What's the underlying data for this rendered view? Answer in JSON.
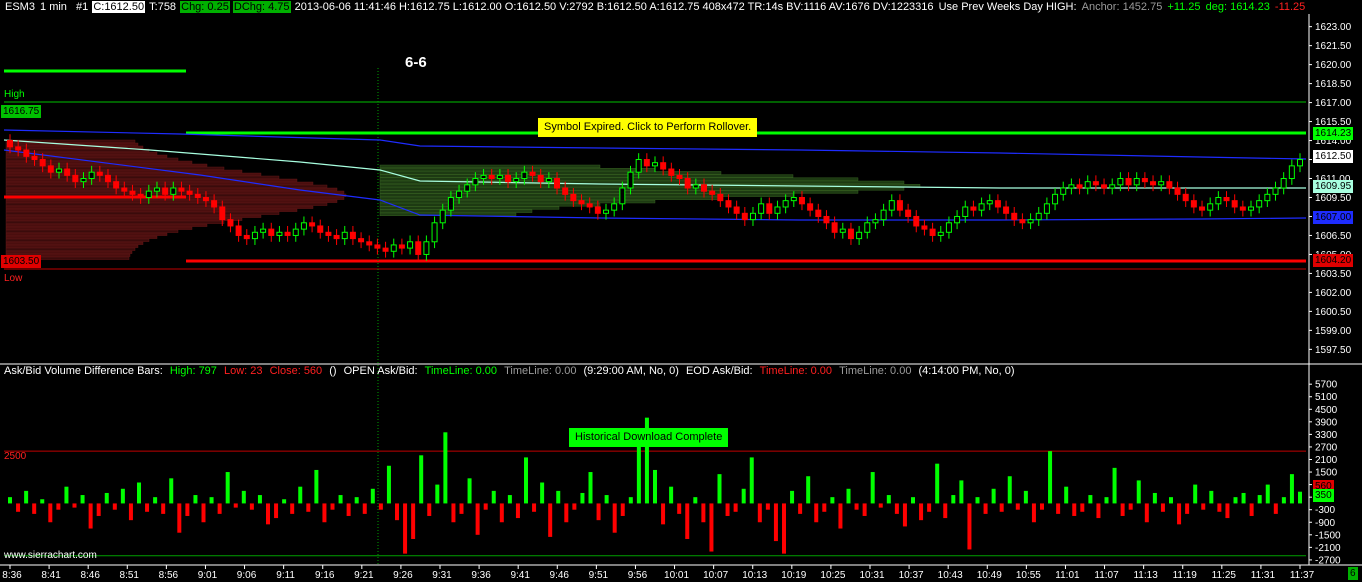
{
  "header": {
    "symbol": "ESM3",
    "interval": "1 min",
    "chart_no": "#1",
    "close_box": "C:1612.50",
    "ticks": "T:758",
    "chg": "Chg: 0.25",
    "dchg": "DChg: 4.75",
    "info": "2013-06-06 11:41:46 H:1612.75 L:1612.00 O:1612.50 V:2792 B:1612.50 A:1612.75 408x472 TR:14s BV:1116 AV:1676 DV:1223316",
    "prev_weeks": "Use Prev Weeks Day HIGH:",
    "anchor": "Anchor: 1452.75",
    "plus": "+11.25",
    "deg": "deg: 1614.23",
    "minus": "-11.25"
  },
  "chart_title": "6-6",
  "notices": {
    "rollover": "Symbol Expired. Click to Perform Rollover.",
    "download": "Historical Download Complete"
  },
  "markers": {
    "high_label": "High",
    "high_value": "1616.75",
    "low_value": "1603.50",
    "low_label": "Low",
    "line_1614": "1614.23",
    "last_price": "1612.50",
    "vwap": "1609.95",
    "blue_lower": "1607.00",
    "line_1604": "1604.20",
    "sub_2500": "2500",
    "sub_cur": "560",
    "sub_cur2": "350"
  },
  "subgraph": {
    "name": "Ask/Bid Volume Difference Bars:",
    "high": "High: 797",
    "low": "Low: 23",
    "close": "Close: 560",
    "paren": "()",
    "open_name": "OPEN Ask/Bid:",
    "open_tl": "TimeLine: 0.00",
    "open_tl2": "TimeLine: 0.00",
    "open_info": "(9:29:00 AM, No, 0)",
    "eod_name": "EOD Ask/Bid:",
    "eod_tl": "TimeLine: 0.00",
    "eod_tl2": "TimeLine: 0.00",
    "eod_info": "(4:14:00 PM, No, 0)"
  },
  "watermark": "www.sierrachart.com",
  "corner_tag": "6",
  "colors": {
    "up": "#00ff00",
    "down": "#ff0000",
    "bg": "#000000",
    "blue": "#1e2cff",
    "cyan": "#a8ffe0"
  },
  "chart_data": [
    {
      "type": "candlestick",
      "title": "6-6",
      "price_axis": [
        "1623.00",
        "1621.50",
        "1620.00",
        "1618.50",
        "1617.00",
        "1615.50",
        "1614.00",
        "1612.50",
        "1611.00",
        "1609.50",
        "1608.00",
        "1606.50",
        "1605.00",
        "1603.50",
        "1602.00",
        "1600.50",
        "1599.00",
        "1597.50"
      ],
      "ylim": [
        1596.5,
        1624.0
      ],
      "x_ticks": [
        "8:36",
        "8:41",
        "8:46",
        "8:51",
        "8:56",
        "9:01",
        "9:06",
        "9:11",
        "9:16",
        "9:21",
        "9:26",
        "9:31",
        "9:36",
        "9:41",
        "9:46",
        "9:51",
        "9:56",
        "10:01",
        "10:07",
        "10:13",
        "10:19",
        "10:25",
        "10:31",
        "10:37",
        "10:43",
        "10:49",
        "10:55",
        "11:01",
        "11:07",
        "11:13",
        "11:19",
        "11:25",
        "11:31",
        "11:37"
      ],
      "closes": [
        1613.5,
        1613.25,
        1612.75,
        1612.5,
        1612.0,
        1611.5,
        1611.75,
        1611.25,
        1610.75,
        1611.0,
        1611.5,
        1611.25,
        1610.75,
        1610.25,
        1610.0,
        1609.75,
        1609.5,
        1610.0,
        1610.25,
        1609.75,
        1610.25,
        1610.0,
        1609.75,
        1609.5,
        1609.25,
        1608.75,
        1607.75,
        1607.25,
        1606.5,
        1606.25,
        1606.75,
        1607.0,
        1606.5,
        1606.75,
        1606.5,
        1607.0,
        1607.5,
        1607.25,
        1606.75,
        1606.5,
        1606.25,
        1606.75,
        1606.25,
        1606.0,
        1605.75,
        1605.5,
        1605.25,
        1605.75,
        1605.5,
        1606.0,
        1605.0,
        1606.0,
        1607.5,
        1608.5,
        1609.5,
        1610.0,
        1610.5,
        1611.0,
        1611.25,
        1611.0,
        1611.25,
        1610.75,
        1611.0,
        1611.5,
        1611.25,
        1610.75,
        1611.0,
        1610.25,
        1609.75,
        1609.25,
        1609.0,
        1608.75,
        1608.25,
        1608.5,
        1609.0,
        1610.25,
        1611.5,
        1612.5,
        1612.0,
        1612.25,
        1611.75,
        1611.25,
        1611.0,
        1610.25,
        1610.5,
        1610.0,
        1609.75,
        1609.25,
        1608.75,
        1608.25,
        1607.75,
        1608.25,
        1609.0,
        1608.25,
        1608.75,
        1609.25,
        1609.5,
        1609.0,
        1608.5,
        1608.0,
        1607.5,
        1606.75,
        1607.0,
        1606.25,
        1606.75,
        1607.5,
        1607.75,
        1608.5,
        1609.25,
        1608.5,
        1608.0,
        1607.25,
        1607.0,
        1606.5,
        1606.75,
        1607.5,
        1608.0,
        1608.75,
        1608.5,
        1609.0,
        1609.25,
        1608.75,
        1608.25,
        1607.75,
        1607.5,
        1607.75,
        1608.25,
        1609.0,
        1609.75,
        1610.25,
        1610.5,
        1610.25,
        1610.75,
        1610.5,
        1610.25,
        1610.5,
        1611.0,
        1610.5,
        1611.0,
        1610.75,
        1610.5,
        1610.75,
        1610.25,
        1609.75,
        1609.25,
        1608.75,
        1608.5,
        1609.0,
        1609.5,
        1609.25,
        1608.75,
        1608.5,
        1608.75,
        1609.25,
        1609.75,
        1610.25,
        1611.0,
        1612.0,
        1612.5
      ],
      "sub_ylim": [
        -2800,
        5900
      ],
      "sub_axis": [
        "5700",
        "5100",
        "4500",
        "3900",
        "3300",
        "2700",
        "2100",
        "1500",
        "900",
        "300",
        "-300",
        "-900",
        "-1500",
        "-2100",
        "-2700"
      ],
      "sub_values": [
        300,
        -400,
        600,
        -500,
        200,
        -900,
        -300,
        800,
        -200,
        400,
        -1200,
        -600,
        500,
        -300,
        700,
        -800,
        1000,
        -400,
        300,
        -500,
        1200,
        -1400,
        -600,
        400,
        -900,
        300,
        -500,
        1500,
        -200,
        600,
        -300,
        400,
        -1000,
        -700,
        200,
        -500,
        800,
        -400,
        1600,
        -900,
        -300,
        400,
        -600,
        300,
        -500,
        700,
        -300,
        1800,
        -800,
        -2400,
        -1700,
        2300,
        -600,
        900,
        3400,
        -900,
        -500,
        1200,
        -1500,
        -300,
        600,
        -900,
        400,
        -700,
        2200,
        -400,
        1000,
        -1600,
        600,
        -900,
        -300,
        500,
        1500,
        -800,
        400,
        -1400,
        -600,
        300,
        3200,
        4100,
        1600,
        -1000,
        800,
        -500,
        -1700,
        300,
        -900,
        -2300,
        1400,
        -600,
        -400,
        700,
        2200,
        -900,
        -300,
        -1800,
        -2400,
        600,
        -500,
        1300,
        -900,
        -400,
        300,
        -1200,
        700,
        -300,
        -600,
        1500,
        -200,
        400,
        -500,
        -1100,
        300,
        -800,
        -400,
        1900,
        -700,
        400,
        1100,
        -2200,
        300,
        -500,
        700,
        -400,
        1300,
        -300,
        600,
        -900,
        -300,
        2500,
        -500,
        800,
        -600,
        -400,
        400,
        -700,
        300,
        1700,
        -600,
        -300,
        1100,
        -900,
        500,
        -400,
        300,
        -1000,
        -500,
        900,
        -300,
        600,
        -400,
        -700,
        300,
        500,
        -600,
        400,
        900,
        -500,
        300,
        1400,
        560
      ]
    }
  ]
}
